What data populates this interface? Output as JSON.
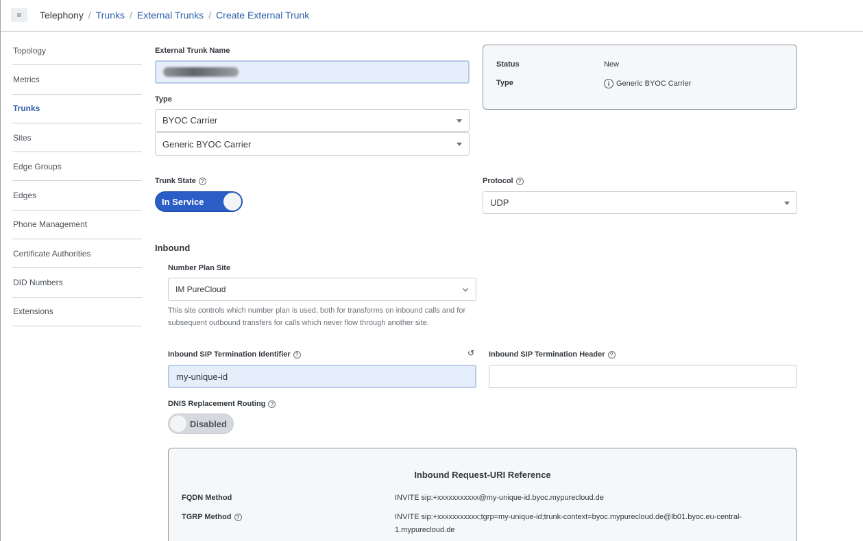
{
  "breadcrumb": {
    "root": "Telephony",
    "items": [
      "Trunks",
      "External Trunks",
      "Create External Trunk"
    ]
  },
  "sidebar": {
    "items": [
      {
        "label": "Topology"
      },
      {
        "label": "Metrics"
      },
      {
        "label": "Trunks",
        "active": true
      },
      {
        "label": "Sites"
      },
      {
        "label": "Edge Groups"
      },
      {
        "label": "Edges"
      },
      {
        "label": "Phone Management"
      },
      {
        "label": "Certificate Authorities"
      },
      {
        "label": "DID Numbers"
      },
      {
        "label": "Extensions"
      }
    ]
  },
  "form": {
    "name_label": "External Trunk Name",
    "type_label": "Type",
    "type_value": "BYOC Carrier",
    "subtype_value": "Generic BYOC Carrier",
    "trunk_state_label": "Trunk State",
    "trunk_state_value": "In Service",
    "protocol_label": "Protocol",
    "protocol_value": "UDP"
  },
  "status_panel": {
    "status_key": "Status",
    "status_value": "New",
    "type_key": "Type",
    "type_value": "Generic BYOC Carrier"
  },
  "inbound": {
    "title": "Inbound",
    "number_plan_label": "Number Plan Site",
    "number_plan_value": "IM PureCloud",
    "number_plan_help": "This site controls which number plan is used, both for transforms on inbound calls and for subsequent outbound transfers for calls which never flow through another site.",
    "sip_id_label": "Inbound SIP Termination Identifier",
    "sip_id_value": "my-unique-id",
    "sip_header_label": "Inbound SIP Termination Header",
    "sip_header_value": "",
    "dnis_label": "DNIS Replacement Routing",
    "dnis_value": "Disabled"
  },
  "reference": {
    "title": "Inbound Request-URI Reference",
    "fqdn_key": "FQDN Method",
    "fqdn_value": "INVITE sip:+xxxxxxxxxxx@my-unique-id.byoc.mypurecloud.de",
    "tgrp_key": "TGRP Method",
    "tgrp_value": "INVITE sip:+xxxxxxxxxxx;tgrp=my-unique-id;trunk-context=byoc.mypurecloud.de@lb01.byoc.eu-central-1.mypurecloud.de"
  },
  "icons": {
    "menu": "hamburger-icon",
    "help": "question-circle-icon",
    "info": "info-circle-icon",
    "reset": "reset-icon"
  },
  "colors": {
    "accent": "#2a5ec6",
    "link": "#2e5fa8"
  }
}
